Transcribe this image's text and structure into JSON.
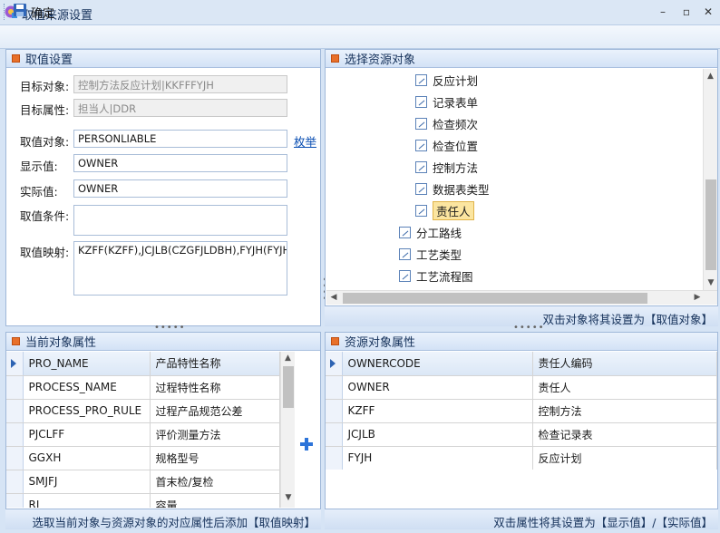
{
  "window": {
    "title": "取值来源设置",
    "min_label": "–",
    "max_label": "▫",
    "close_label": "✕"
  },
  "toolbar": {
    "confirm_label": "确定"
  },
  "left_panel": {
    "header": "取值设置",
    "target_object_label": "目标对象:",
    "target_object_value": "控制方法反应计划|KKFFFYJH",
    "target_attr_label": "目标属性:",
    "target_attr_value": "担当人|DDR",
    "source_object_label": "取值对象:",
    "source_object_value": "PERSONLIABLE",
    "enum_link": "枚举",
    "display_value_label": "显示值:",
    "display_value_value": "OWNER",
    "actual_value_label": "实际值:",
    "actual_value_value": "OWNER",
    "condition_label": "取值条件:",
    "condition_value": "",
    "mapping_label": "取值映射:",
    "mapping_value": "KZFF(KZFF),JCJLB(CZGFJLDBH),FYJH(FYJH)"
  },
  "right_panel": {
    "header": "选择资源对象",
    "tree_items": [
      {
        "label": "反应计划"
      },
      {
        "label": "记录表单"
      },
      {
        "label": "检查频次"
      },
      {
        "label": "检查位置"
      },
      {
        "label": "控制方法"
      },
      {
        "label": "数据表类型"
      },
      {
        "label": "责任人"
      },
      {
        "label": "分工路线"
      },
      {
        "label": "工艺类型"
      },
      {
        "label": "工艺流程图"
      }
    ],
    "hint": "双击对象将其设置为【取值对象】"
  },
  "current_attrs": {
    "header": "当前对象属性",
    "columns": [
      "PRO_NAME",
      "产品特性名称"
    ],
    "rows": [
      [
        "PROCESS_NAME",
        "过程特性名称"
      ],
      [
        "PROCESS_PRO_RULE",
        "过程产品规范公差"
      ],
      [
        "PJCLFF",
        "评价测量方法"
      ],
      [
        "GGXH",
        "规格型号"
      ],
      [
        "SMJFJ",
        "首末检/复检"
      ],
      [
        "RL",
        "容量"
      ]
    ],
    "add_icon": "plus-icon",
    "hint": "选取当前对象与资源对象的对应属性后添加【取值映射】"
  },
  "resource_attrs": {
    "header": "资源对象属性",
    "columns": [
      "OWNERCODE",
      "责任人编码"
    ],
    "rows": [
      [
        "OWNER",
        "责任人"
      ],
      [
        "KZFF",
        "控制方法"
      ],
      [
        "JCJLB",
        "检查记录表"
      ],
      [
        "FYJH",
        "反应计划"
      ]
    ],
    "hint": "双击属性将其设置为【显示值】/【实际值】"
  },
  "colors": {
    "accent": "#2d63b3",
    "header_square": "#e8702a",
    "selection": "#fbe5a0"
  }
}
